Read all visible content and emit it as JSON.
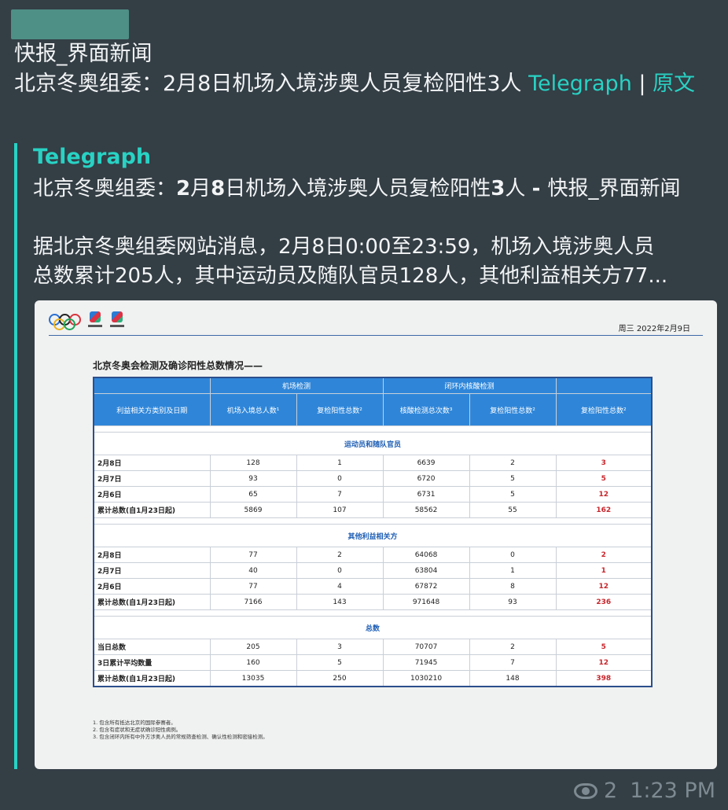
{
  "message": {
    "source": "快报_界面新闻",
    "headline": "北京冬奥组委：2月8日机场入境涉奥人员复检阳性3人",
    "link_telegraph": "Telegraph",
    "separator": "|",
    "link_original": "原文"
  },
  "preview": {
    "site": "Telegraph",
    "title_a": "北京冬奥组委：",
    "title_b": "2",
    "title_c": "月",
    "title_d": "8",
    "title_e": "日机场入境涉奥人员复检阳性",
    "title_f": "3",
    "title_g": "人 ",
    "title_h": "- ",
    "title_i": "快报_界面新闻",
    "body_line1": "据北京冬奥组委网站消息，2月8日0:00至23:59，机场入境涉奥人员",
    "body_line2": "总数累计205人，其中运动员及随队官员128人，其他利益相关方77..."
  },
  "document": {
    "date": "周三 2022年2月9日",
    "title": "北京冬奥会检测及确诊阳性总数情况——",
    "group_airport": "机场检测",
    "group_closed_loop": "闭环内核酸检测",
    "col_label": "利益相关方类别及日期",
    "col1": "机场入境总人数¹",
    "col2": "复检阳性总数²",
    "col3": "核酸检测总次数³",
    "col4": "复检阳性总数²",
    "col5": "复检阳性总数²",
    "sections": [
      {
        "name": "运动员和随队官员",
        "rows": [
          [
            "2月8日",
            "128",
            "1",
            "6639",
            "2",
            "3"
          ],
          [
            "2月7日",
            "93",
            "0",
            "6720",
            "5",
            "5"
          ],
          [
            "2月6日",
            "65",
            "7",
            "6731",
            "5",
            "12"
          ],
          [
            "累计总数(自1月23日起)",
            "5869",
            "107",
            "58562",
            "55",
            "162"
          ]
        ]
      },
      {
        "name": "其他利益相关方",
        "rows": [
          [
            "2月8日",
            "77",
            "2",
            "64068",
            "0",
            "2"
          ],
          [
            "2月7日",
            "40",
            "0",
            "63804",
            "1",
            "1"
          ],
          [
            "2月6日",
            "77",
            "4",
            "67872",
            "8",
            "12"
          ],
          [
            "累计总数(自1月23日起)",
            "7166",
            "143",
            "971648",
            "93",
            "236"
          ]
        ]
      },
      {
        "name": "总数",
        "rows": [
          [
            "当日总数",
            "205",
            "3",
            "70707",
            "2",
            "5"
          ],
          [
            "3日累计平均数量",
            "160",
            "5",
            "71945",
            "7",
            "12"
          ],
          [
            "累计总数(自1月23日起)",
            "13035",
            "250",
            "1030210",
            "148",
            "398"
          ]
        ]
      }
    ],
    "notes": [
      "1. 包含所有抵达北京的国际参赛者。",
      "2. 包含有症状和无症状确诊阳性病例。",
      "3. 包含闭环内所有中外方涉奥人员的常规筛查检测、确认性检测和密接检测。"
    ]
  },
  "footer": {
    "views": "2",
    "time": "1:23 PM"
  },
  "colors": {
    "background": "#343e45",
    "accent": "#28d2c4",
    "table_header": "#2f86d9",
    "positive_red": "#c8262c"
  }
}
